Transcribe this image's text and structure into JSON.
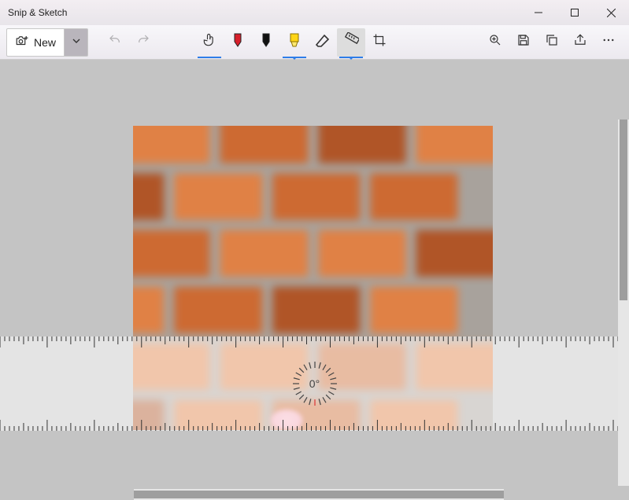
{
  "titlebar": {
    "title": "Snip & Sketch"
  },
  "toolbar": {
    "new_label": "New",
    "icons": {
      "camera": "camera-plus-icon",
      "chevron": "chevron-down-icon",
      "undo": "undo-icon",
      "redo": "redo-icon",
      "touch": "touch-writing-icon",
      "ballpoint": "ballpoint-pen-icon",
      "pencil": "pencil-icon",
      "highlighter": "highlighter-icon",
      "eraser": "eraser-icon",
      "ruler": "ruler-icon",
      "crop": "crop-icon",
      "zoom": "zoom-icon",
      "save": "save-icon",
      "copy": "copy-icon",
      "share": "share-icon",
      "more": "more-icon"
    }
  },
  "ruler": {
    "angle_label": "0°"
  }
}
